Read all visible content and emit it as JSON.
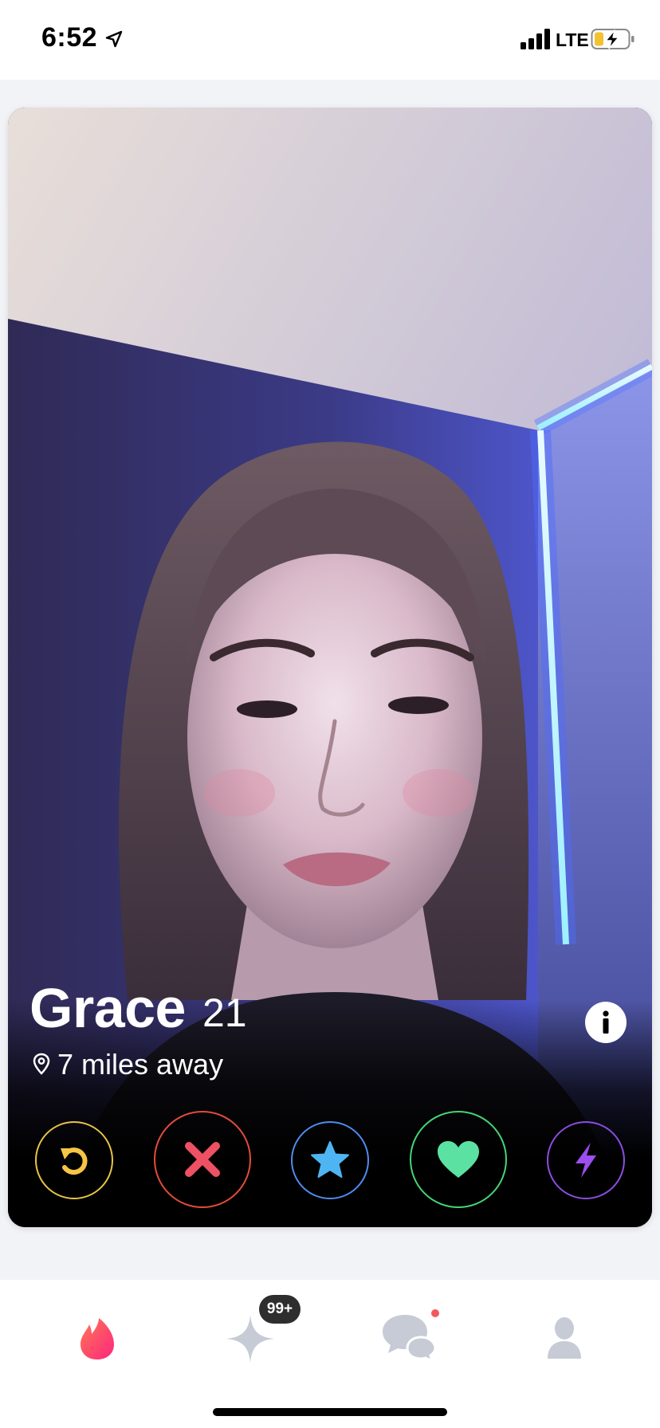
{
  "status_bar": {
    "time": "6:52",
    "network": "LTE",
    "location_icon": "location-arrow-icon",
    "battery_state": "charging"
  },
  "profile": {
    "name": "Grace",
    "age": "21",
    "distance": "7 miles away",
    "photo": "selfie in a room lit by blue LED strip lights"
  },
  "actions": [
    {
      "name": "rewind",
      "icon": "rewind-icon",
      "color": "#e8c545"
    },
    {
      "name": "nope",
      "icon": "close-icon",
      "color": "#e44b3b"
    },
    {
      "name": "super-like",
      "icon": "star-icon",
      "color": "#4f8cf0"
    },
    {
      "name": "like",
      "icon": "heart-icon",
      "color": "#45d576"
    },
    {
      "name": "boost",
      "icon": "lightning-icon",
      "color": "#8b4ee0"
    }
  ],
  "tab_bar": {
    "tabs": [
      {
        "name": "discover",
        "icon": "flame-icon",
        "active": true
      },
      {
        "name": "top-picks",
        "icon": "sparkle-icon",
        "active": false
      },
      {
        "name": "messages",
        "icon": "chat-bubbles-icon",
        "active": false
      },
      {
        "name": "profile",
        "icon": "person-icon",
        "active": false
      }
    ],
    "top_picks_badge": "99+"
  },
  "colors": {
    "brand": "#fd5068",
    "inactive_tab": "#c6cbd6",
    "deck_background": "#f2f3f7"
  }
}
